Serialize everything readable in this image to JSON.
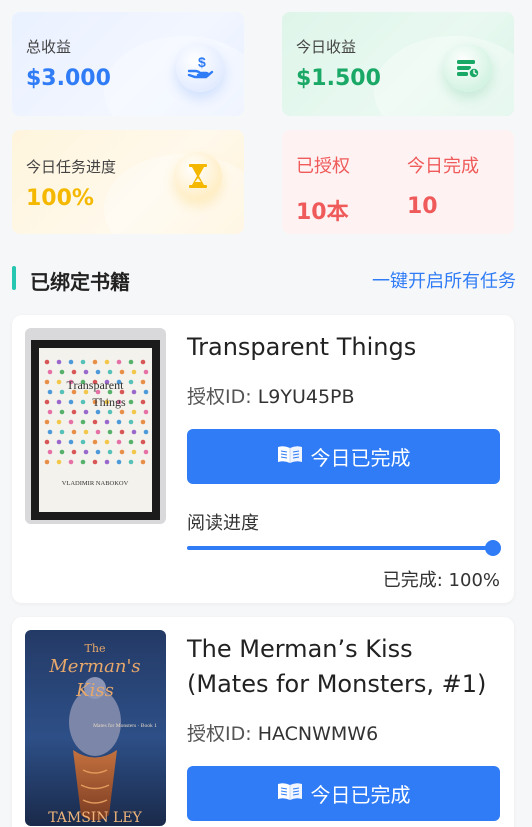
{
  "stats": {
    "total": {
      "label": "总收益",
      "value": "$3.000"
    },
    "today": {
      "label": "今日收益",
      "value": "$1.500"
    },
    "progress": {
      "label": "今日任务进度",
      "value": "100%"
    },
    "authorized": {
      "label": "已授权",
      "value": "10本"
    },
    "completed": {
      "label": "今日完成",
      "value": "10"
    }
  },
  "section": {
    "title": "已绑定书籍",
    "action": "一键开启所有任务"
  },
  "books": [
    {
      "title": "Transparent Things",
      "auth_key": "授权ID:",
      "auth_id": "L9YU45PB",
      "button_label": "今日已完成",
      "read_label": "阅读进度",
      "progress_text": "已完成: 100%",
      "progress": 1.0,
      "cover_title_1": "Transparent",
      "cover_title_2": "Things",
      "cover_author": "VLADIMIR NABOKOV"
    },
    {
      "title": "The Merman’s Kiss (Mates for Monsters, #1)",
      "auth_key": "授权ID:",
      "auth_id": "HACNWMW6",
      "button_label": "今日已完成",
      "cover_title_1": "The",
      "cover_title_2": "Merman's",
      "cover_title_3": "Kiss",
      "cover_series": "Mates for Monsters · Book 1",
      "cover_author": "TAMSIN LEY"
    }
  ],
  "colors": {
    "accent": "#2f7cf6",
    "green": "#1aa866",
    "yellow": "#f5b800",
    "red": "#ef5a5a",
    "teal": "#26c6b0"
  },
  "icons": {
    "total": "money-hand-icon",
    "today": "wallet-icon",
    "progress": "hourglass-icon",
    "button": "open-book-icon"
  }
}
